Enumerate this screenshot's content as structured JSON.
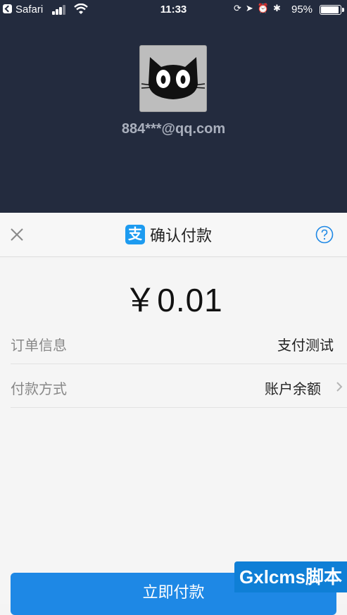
{
  "status_bar": {
    "back_app": "Safari",
    "time": "11:33",
    "battery": "95%"
  },
  "account": {
    "email": "884***@qq.com"
  },
  "header": {
    "title": "确认付款",
    "logo_glyph": "支"
  },
  "payment": {
    "amount": "￥0.01",
    "rows": [
      {
        "label": "订单信息",
        "value": "支付测试"
      },
      {
        "label": "付款方式",
        "value": "账户余额"
      }
    ],
    "button": "立即付款"
  },
  "watermark": "Gxlcms脚本",
  "colors": {
    "top_bg": "#232b3e",
    "accent": "#1e88e5"
  }
}
